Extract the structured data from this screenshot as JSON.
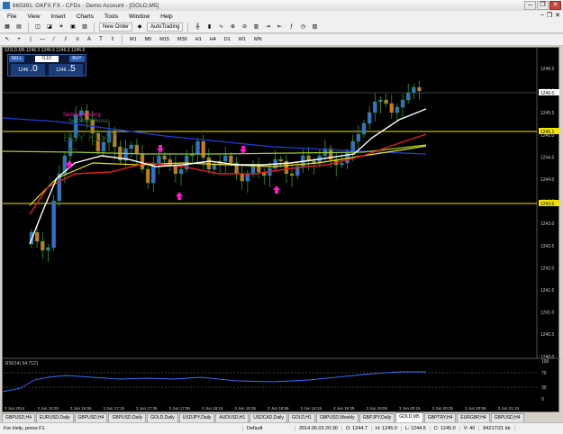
{
  "window": {
    "title": "665391: GKFX FX - CFDs - Demo Account - [GOLD,M5]",
    "buttons": [
      "–",
      "❐",
      "✕"
    ],
    "mdi_buttons": [
      "–",
      "❐",
      "✕"
    ]
  },
  "menu": [
    "File",
    "View",
    "Insert",
    "Charts",
    "Tools",
    "Window",
    "Help"
  ],
  "toolbar1": {
    "new_order": "New Order",
    "autotrading": "AutoTrading"
  },
  "toolbar2": {
    "timeframes": [
      "M1",
      "M5",
      "M15",
      "M30",
      "H1",
      "H4",
      "D1",
      "W1",
      "MN"
    ]
  },
  "chart": {
    "symbol_title": "GOLD,M5  1246.3 1246.6 1246.3 1246.6",
    "trade_panel": {
      "sell": "SELL",
      "buy": "BUY",
      "lot": "0.10",
      "bid_small": "1246",
      "bid_big": ".0",
      "ask_small": "1246",
      "ask_big": ".5"
    },
    "annotations": {
      "line1": "Sedang kosong",
      "line2": "Sell Much Bonus",
      "line3": "BUY KUAT",
      "line4": "Sell"
    },
    "price_labels": [
      "1246.5",
      "1246.0",
      "1245.5",
      "1245.0",
      "1244.5",
      "1244.0",
      "1243.5",
      "1243.0",
      "1242.5",
      "1242.0",
      "1241.5",
      "1241.0",
      "1240.5",
      "1240.0"
    ],
    "price_current": "1246.0",
    "level_upper": "1245.1",
    "level_lower": "1243.6",
    "time_labels": [
      "3 Jun 2014",
      "3 Jun 16:25",
      "3 Jun 16:55",
      "3 Jun 17:15",
      "3 Jun 17:35",
      "3 Jun 17:55",
      "3 Jun 18:15",
      "3 Jun 18:35",
      "3 Jun 18:55",
      "3 Jun 19:15",
      "3 Jun 19:35",
      "3 Jun 19:55",
      "3 Jun 20:15",
      "3 Jun 20:35",
      "3 Jun 20:55",
      "3 Jun 21:15"
    ],
    "rsi_label": "RSI(14) 64.7121",
    "rsi_levels": [
      "70",
      "30",
      "0"
    ],
    "rsi_top": "100"
  },
  "tabs": [
    "GBPUSD,H4",
    "EURUSD,Daily",
    "GBPUSD,H4",
    "GBPUSD,Daily",
    "GOLD,Daily",
    "USDJPY,Daily",
    "AUDUSD,H1",
    "USDCAD,Daily",
    "GOLD,H1",
    "GBPUSD,Weekly",
    "GBPJPY,Daily",
    "GOLD,M5",
    "GBPTRY,H4",
    "EURGBP,H4",
    "GBPUSD,H4"
  ],
  "active_tab": "GOLD,M5",
  "status": {
    "help": "For Help, press F1",
    "profile": "Default",
    "datetime": "2014.06.03 20:30",
    "open": "O: 1244.7",
    "high": "H: 1245.0",
    "low": "L: 1244.5",
    "close": "C: 1245.0",
    "volume": "V: 40",
    "traffic": "84217/21 kb"
  }
}
